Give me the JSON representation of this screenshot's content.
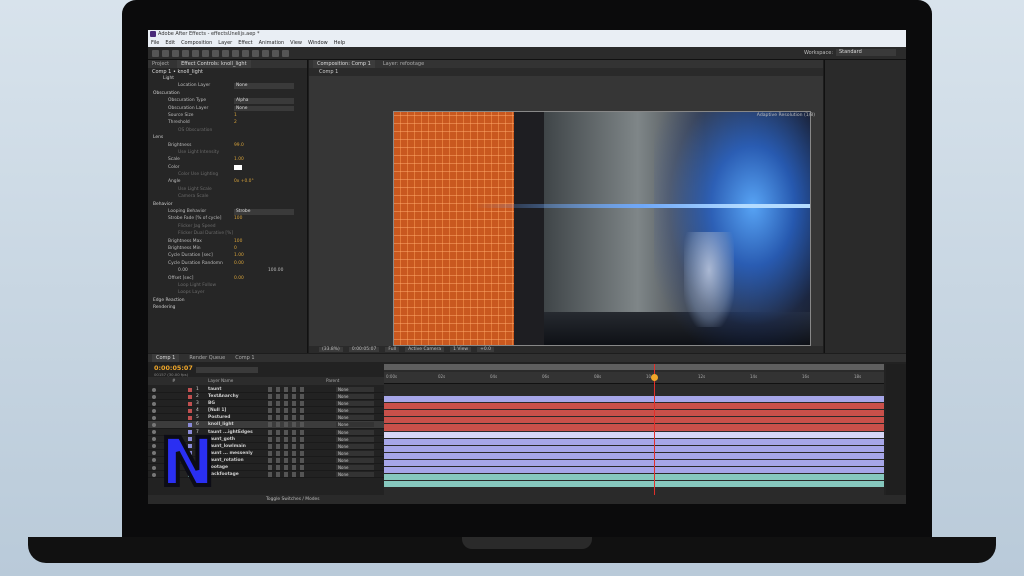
{
  "titlebar": {
    "title": "Adobe After Effects - effectsUnelijs.aep *"
  },
  "menubar": [
    "File",
    "Edit",
    "Composition",
    "Layer",
    "Effect",
    "Animation",
    "View",
    "Window",
    "Help"
  ],
  "workspace": {
    "label": "Workspace:",
    "value": "Standard"
  },
  "effect_controls": {
    "tabs": [
      "Project",
      "Effect Controls: knoll_light"
    ],
    "comp_label": "Comp 1 • knoll_light",
    "properties": [
      {
        "name": "Light",
        "indent": 3,
        "type": "section"
      },
      {
        "name": "Location Layer",
        "indent": 6,
        "type": "drop",
        "value": "None"
      },
      {
        "name": "Obscuration",
        "indent": 1,
        "type": "section"
      },
      {
        "name": "Obscuration Type",
        "indent": 4,
        "type": "drop",
        "value": "Alpha"
      },
      {
        "name": "Obscuration Layer",
        "indent": 4,
        "type": "drop",
        "value": "None"
      },
      {
        "name": "Source Size",
        "indent": 4,
        "type": "value",
        "value": "1"
      },
      {
        "name": "Threshold",
        "indent": 4,
        "type": "value",
        "value": "2"
      },
      {
        "name": "OS Obscuration",
        "indent": 6,
        "type": "dim"
      },
      {
        "name": "Lens",
        "indent": 1,
        "type": "section"
      },
      {
        "name": "Brightness",
        "indent": 4,
        "type": "value",
        "value": "99.0"
      },
      {
        "name": "Use Light Intensity",
        "indent": 6,
        "type": "dim"
      },
      {
        "name": "Scale",
        "indent": 4,
        "type": "value",
        "value": "1.00"
      },
      {
        "name": "Color",
        "indent": 4,
        "type": "swatch"
      },
      {
        "name": "Color Use Lighting",
        "indent": 6,
        "type": "dim"
      },
      {
        "name": "Angle",
        "indent": 4,
        "type": "value",
        "value": "0x +0.0°"
      },
      {
        "name": "Use Light Scale",
        "indent": 6,
        "type": "dim"
      },
      {
        "name": "Camera Scale",
        "indent": 6,
        "type": "dim"
      },
      {
        "name": "Behavior",
        "indent": 1,
        "type": "section"
      },
      {
        "name": "Looping Behavior",
        "indent": 4,
        "type": "drop",
        "value": "Strobe"
      },
      {
        "name": "Strobe Fade [% of cycle]",
        "indent": 4,
        "type": "value",
        "value": "100"
      },
      {
        "name": "Flicker Jag Speed",
        "indent": 6,
        "type": "dim"
      },
      {
        "name": "Flicker Dual Durative [%]",
        "indent": 6,
        "type": "dim"
      },
      {
        "name": "Brightness Max",
        "indent": 4,
        "type": "value",
        "value": "100"
      },
      {
        "name": "Brightness Min",
        "indent": 4,
        "type": "value",
        "value": "0"
      },
      {
        "name": "Cycle Duration [sec]",
        "indent": 4,
        "type": "value",
        "value": "1.00"
      },
      {
        "name": "Cycle Duration Randomn",
        "indent": 4,
        "type": "value",
        "value": "0.00"
      },
      {
        "name": "0.00",
        "indent": 6,
        "type": "range",
        "value": "100.00"
      },
      {
        "name": "Offset [sec]",
        "indent": 4,
        "type": "value",
        "value": "0.00"
      },
      {
        "name": "Loop Light Follow",
        "indent": 6,
        "type": "dim"
      },
      {
        "name": "Loops Layer",
        "indent": 6,
        "type": "dim"
      },
      {
        "name": "Edge Reaction",
        "indent": 1,
        "type": "section"
      },
      {
        "name": "Rendering",
        "indent": 1,
        "type": "section"
      }
    ]
  },
  "viewer": {
    "tabs": [
      "Composition: Comp 1",
      "Layer: refootage"
    ],
    "subtab": "Comp 1",
    "adaptive": "Adaptive Resolution (1/8)",
    "controls": [
      "(33.8%)",
      "0:00:05:07",
      "Full",
      "Active Camera",
      "1 View",
      "+0.0"
    ]
  },
  "timeline": {
    "tabs": [
      "Comp 1",
      "Render Queue",
      "Comp 1"
    ],
    "timecode": "0:00:05:07",
    "fps": "00157 (30.00 fps)",
    "header": {
      "num": "#",
      "name": "Layer Name",
      "parent": "Parent"
    },
    "ruler_ticks": [
      "0:00s",
      "02s",
      "04s",
      "06s",
      "08s",
      "10s",
      "12s",
      "14s",
      "16s",
      "18s"
    ],
    "layers": [
      {
        "num": "1",
        "name": "taunt",
        "label_color": "#c05050",
        "parent": "None"
      },
      {
        "num": "2",
        "name": "TextAnarchy",
        "label_color": "#c05050",
        "parent": "None"
      },
      {
        "num": "3",
        "name": "BG",
        "label_color": "#c05050",
        "parent": "None"
      },
      {
        "num": "4",
        "name": "[Null 1]",
        "label_color": "#c05050",
        "parent": "None"
      },
      {
        "num": "5",
        "name": "Postured",
        "label_color": "#c05050",
        "parent": "None"
      },
      {
        "num": "6",
        "name": "knoll_light",
        "label_color": "#8a8ad8",
        "parent": "None"
      },
      {
        "num": "7",
        "name": "taunt ...ightEdges",
        "label_color": "#8a8ad8",
        "parent": "None"
      },
      {
        "num": "8",
        "name": "taunt_goth",
        "label_color": "#8a8ad8",
        "parent": "None"
      },
      {
        "num": "9",
        "name": "taunt_lowlmain",
        "label_color": "#8a8ad8",
        "parent": "None"
      },
      {
        "num": "10",
        "name": "taunt ... messenly",
        "label_color": "#8a8ad8",
        "parent": "None"
      },
      {
        "num": "11",
        "name": "taunt_rotation",
        "label_color": "#8a8ad8",
        "parent": "None"
      },
      {
        "num": "12",
        "name": "Footage",
        "label_color": "#7fbcb5",
        "parent": "None"
      },
      {
        "num": "13",
        "name": "backfootage",
        "label_color": "#7fbcb5",
        "parent": "None"
      }
    ],
    "toggle_label": "Toggle Switches / Modes"
  },
  "logo": {
    "letter": "N"
  },
  "colors": {
    "timecode": "#f0a72a",
    "playhead": "#e0302b",
    "red_bar": "#c9504a",
    "purple_bar": "#a6a6e8",
    "teal_bar": "#86c8be"
  }
}
